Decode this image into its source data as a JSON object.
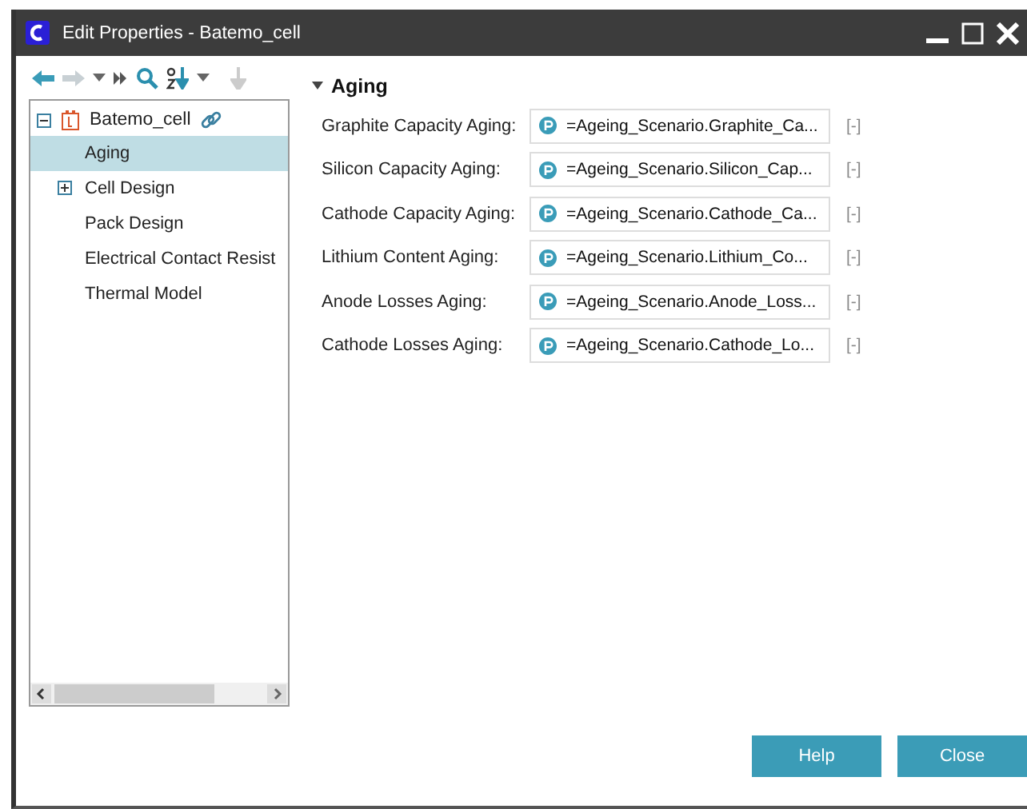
{
  "window": {
    "title": "Edit Properties - Batemo_cell"
  },
  "toolbar": [
    {
      "kind": "back",
      "disabled": false
    },
    {
      "kind": "forward",
      "disabled": true
    },
    {
      "kind": "dropdown",
      "disabled": false
    },
    {
      "kind": "skip",
      "disabled": false
    },
    {
      "kind": "search",
      "disabled": false
    },
    {
      "kind": "sort",
      "disabled": false
    },
    {
      "kind": "dropdown",
      "disabled": false
    },
    {
      "kind": "down",
      "disabled": true
    }
  ],
  "tree": {
    "label": "Batemo_cell",
    "expanded": true,
    "children": [
      {
        "label": "Aging",
        "selected": true
      },
      {
        "label": "Cell Design",
        "selected": false,
        "expanded": false
      },
      {
        "label": "Pack Design",
        "selected": false
      },
      {
        "label": "Electrical Contact Resist",
        "selected": false
      },
      {
        "label": "Thermal Model",
        "selected": false
      }
    ]
  },
  "section": {
    "title": "Aging",
    "expanded": true,
    "properties": [
      {
        "label": "Graphite Capacity Aging:",
        "value": "=Ageing_Scenario.Graphite_Ca...",
        "suffix": "[-]"
      },
      {
        "label": "Silicon Capacity Aging:",
        "value": "=Ageing_Scenario.Silicon_Cap...",
        "suffix": "[-]"
      },
      {
        "label": "Cathode Capacity Aging:",
        "value": "=Ageing_Scenario.Cathode_Ca...",
        "suffix": "[-]"
      },
      {
        "label": "Lithium Content Aging:",
        "value": "=Ageing_Scenario.Lithium_Co...",
        "suffix": "[-]"
      },
      {
        "label": "Anode Losses Aging:",
        "value": "=Ageing_Scenario.Anode_Loss...",
        "suffix": "[-]"
      },
      {
        "label": "Cathode Losses Aging:",
        "value": "=Ageing_Scenario.Cathode_Lo...",
        "suffix": "[-]"
      }
    ]
  },
  "buttons": [
    "Help",
    "Close"
  ]
}
